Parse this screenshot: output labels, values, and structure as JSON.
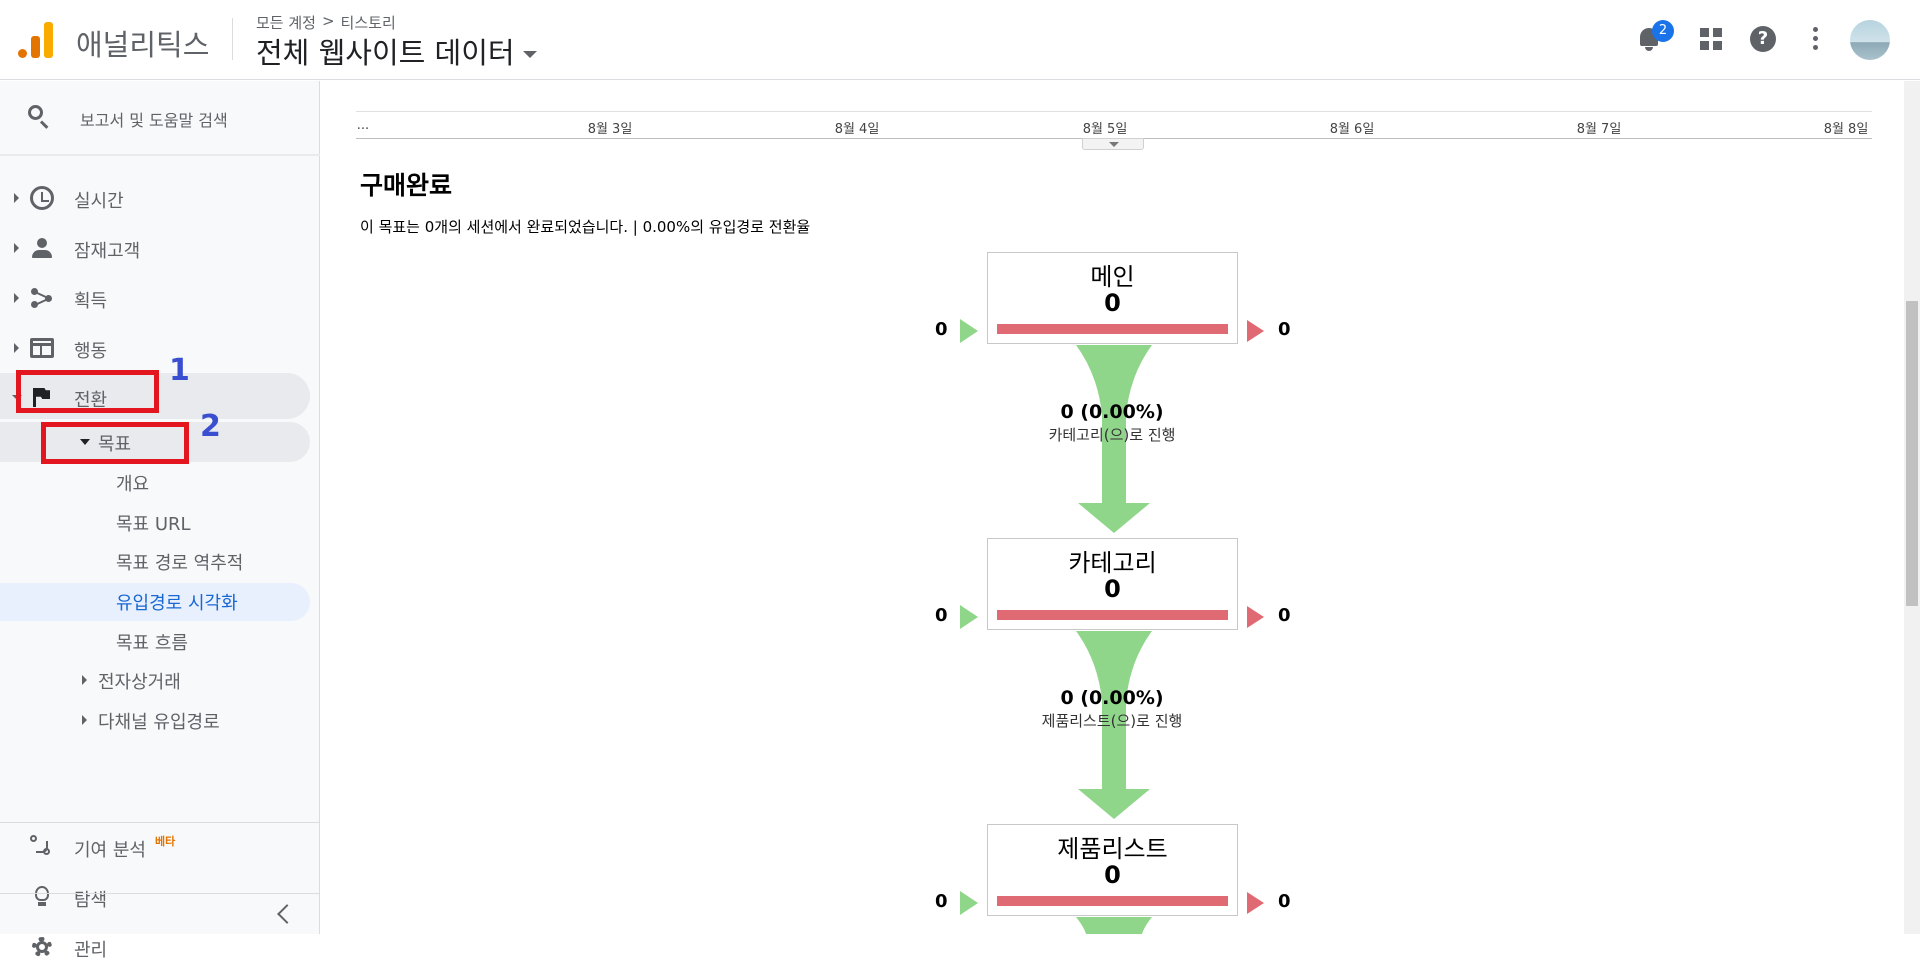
{
  "header": {
    "app_title": "애널리틱스",
    "breadcrumb": [
      "모든 계정",
      ">",
      "티스토리"
    ],
    "view_title": "전체 웹사이트 데이터",
    "notification_count": "2"
  },
  "sidebar": {
    "search_label": "보고서 및 도움말 검색",
    "items": [
      {
        "label": "실시간",
        "icon": "clock-icon"
      },
      {
        "label": "잠재고객",
        "icon": "person-icon"
      },
      {
        "label": "획득",
        "icon": "acquisition-icon"
      },
      {
        "label": "행동",
        "icon": "behavior-icon"
      },
      {
        "label": "전환",
        "icon": "flag-icon"
      }
    ],
    "goals_label": "목표",
    "goal_sub": [
      "개요",
      "목표 URL",
      "목표 경로 역추적",
      "유입경로 시각화",
      "목표 흐름"
    ],
    "ecommerce_label": "전자상거래",
    "multichannel_label": "다채널 유입경로",
    "attribution_label": "기여 분석",
    "beta_label": "베타",
    "discover_label": "탐색",
    "admin_label": "관리",
    "annotations": [
      "1",
      "2"
    ]
  },
  "timeline": {
    "ticks": [
      "...",
      "8월 3일",
      "8월 4일",
      "8월 5일",
      "8월 6일",
      "8월 7일",
      "8월 8일"
    ]
  },
  "goal": {
    "title": "구매완료",
    "summary": "이 목표는 0개의 세션에서 완료되었습니다. | 0.00%의 유입경로 전환율"
  },
  "funnel": {
    "steps": [
      {
        "name": "메인",
        "value": "0",
        "entries": "0",
        "exits": "0"
      },
      {
        "name": "카테고리",
        "value": "0",
        "entries": "0",
        "exits": "0"
      },
      {
        "name": "제품리스트",
        "value": "0",
        "entries": "0",
        "exits": "0"
      }
    ],
    "flows": [
      {
        "value": "0 (0.00%)",
        "label": "카테고리(으)로 진행"
      },
      {
        "value": "0 (0.00%)",
        "label": "제품리스트(으)로 진행"
      }
    ]
  },
  "colors": {
    "entrance_arrow": "#8fd68a",
    "exit_arrow": "#e06a74",
    "flow": "#8fd68a",
    "annotation_box": "#e3161f",
    "annotation_number": "#3a4fcf"
  }
}
